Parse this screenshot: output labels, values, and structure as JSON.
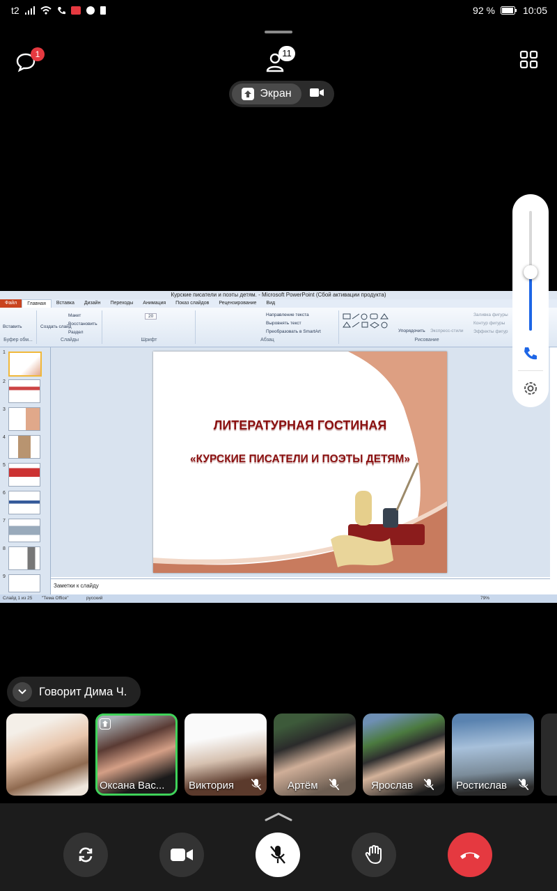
{
  "status_bar": {
    "carrier": "t2",
    "battery": "92 %",
    "time": "10:05"
  },
  "top": {
    "chat_badge": "1",
    "participants_count": "11",
    "screen_label": "Экран"
  },
  "share": {
    "window_title": "Курские писатели и поэты детям. - Microsoft PowerPoint (Сбой активации продукта)",
    "tabs": [
      "Файл",
      "Главная",
      "Вставка",
      "Дизайн",
      "Переходы",
      "Анимация",
      "Показ слайдов",
      "Рецензирование",
      "Вид"
    ],
    "groups": {
      "clipboard": "Буфер обм...",
      "slides": "Слайды",
      "font": "Шрифт",
      "paragraph": "Абзац",
      "drawing": "Рисование"
    },
    "ribbon": {
      "paste": "Вставить",
      "create_slide": "Создать слайд",
      "layout": "Макет",
      "reset": "Восстановить",
      "section": "Раздел",
      "font_size": "20",
      "text_direction": "Направление текста",
      "align_text": "Выровнять текст",
      "smartart": "Преобразовать в SmartArt",
      "arrange": "Упорядочить",
      "quick_styles": "Экспресс-стили",
      "fill": "Заливка фигуры",
      "outline": "Контур фигуры",
      "effects": "Эффекты фигур"
    },
    "slide_title": "ЛИТЕРАТУРНАЯ ГОСТИНАЯ",
    "slide_subtitle": "«КУРСКИЕ ПИСАТЕЛИ И ПОЭТЫ ДЕТЯМ»",
    "slide_numbers": [
      "1",
      "2",
      "3",
      "4",
      "5",
      "6",
      "7",
      "8",
      "9"
    ],
    "notes_placeholder": "Заметки к слайду",
    "status": {
      "slide": "Слайд 1 из 25",
      "theme": "\"Тема Office\"",
      "lang": "русский",
      "zoom": "79%"
    }
  },
  "speaking": "Говорит Дима Ч.",
  "participants": [
    {
      "name": "",
      "muted": false,
      "active": false
    },
    {
      "name": "Оксана Вас...",
      "muted": false,
      "active": true
    },
    {
      "name": "Виктория",
      "muted": true,
      "active": false
    },
    {
      "name": "Артём",
      "muted": true,
      "active": false
    },
    {
      "name": "Ярослав",
      "muted": true,
      "active": false
    },
    {
      "name": "Ростислав",
      "muted": true,
      "active": false
    }
  ],
  "colors": {
    "end_call": "#e53940",
    "speaker_border": "#3fd35a",
    "volume": "#1e66e6"
  }
}
